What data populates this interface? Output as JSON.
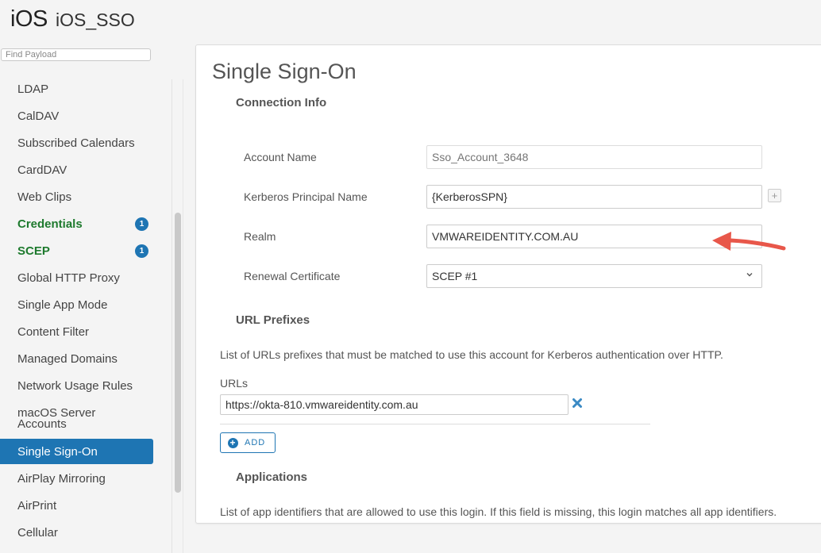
{
  "header": {
    "logo": "iOS",
    "title": "iOS_SSO"
  },
  "search": {
    "placeholder": "Find Payload"
  },
  "sidebar": {
    "items": [
      {
        "label": "LDAP"
      },
      {
        "label": "CalDAV"
      },
      {
        "label": "Subscribed Calendars"
      },
      {
        "label": "CardDAV"
      },
      {
        "label": "Web Clips"
      },
      {
        "label": "Credentials",
        "badge": "1"
      },
      {
        "label": "SCEP",
        "badge": "1"
      },
      {
        "label": "Global HTTP Proxy"
      },
      {
        "label": "Single App Mode"
      },
      {
        "label": "Content Filter"
      },
      {
        "label": "Managed Domains"
      },
      {
        "label": "Network Usage Rules"
      },
      {
        "label": "macOS Server Accounts"
      },
      {
        "label": "Single Sign-On"
      },
      {
        "label": "AirPlay Mirroring"
      },
      {
        "label": "AirPrint"
      },
      {
        "label": "Cellular"
      }
    ],
    "accent": "#1e75b3",
    "configured_color": "#1e7a2e"
  },
  "main": {
    "title": "Single Sign-On",
    "connection": {
      "heading": "Connection Info",
      "account_name": {
        "label": "Account Name",
        "placeholder": "Sso_Account_3648"
      },
      "kerberos": {
        "label": "Kerberos Principal Name",
        "value": "{KerberosSPN}"
      },
      "realm": {
        "label": "Realm",
        "value": "VMWAREIDENTITY.COM.AU"
      },
      "renewal": {
        "label": "Renewal Certificate",
        "value": "SCEP #1"
      },
      "plus_button": "+"
    },
    "url_prefixes": {
      "heading": "URL Prefixes",
      "description": "List of URLs prefixes that must be matched to use this account for Kerberos authentication over HTTP.",
      "urls_label": "URLs",
      "urls": [
        "https://okta-810.vmwareidentity.com.au"
      ],
      "add_label": "ADD"
    },
    "applications": {
      "heading": "Applications",
      "description": "List of app identifiers that are allowed to use this login. If this field is missing, this login matches all app identifiers."
    }
  },
  "annotation_color": "#e8574a"
}
